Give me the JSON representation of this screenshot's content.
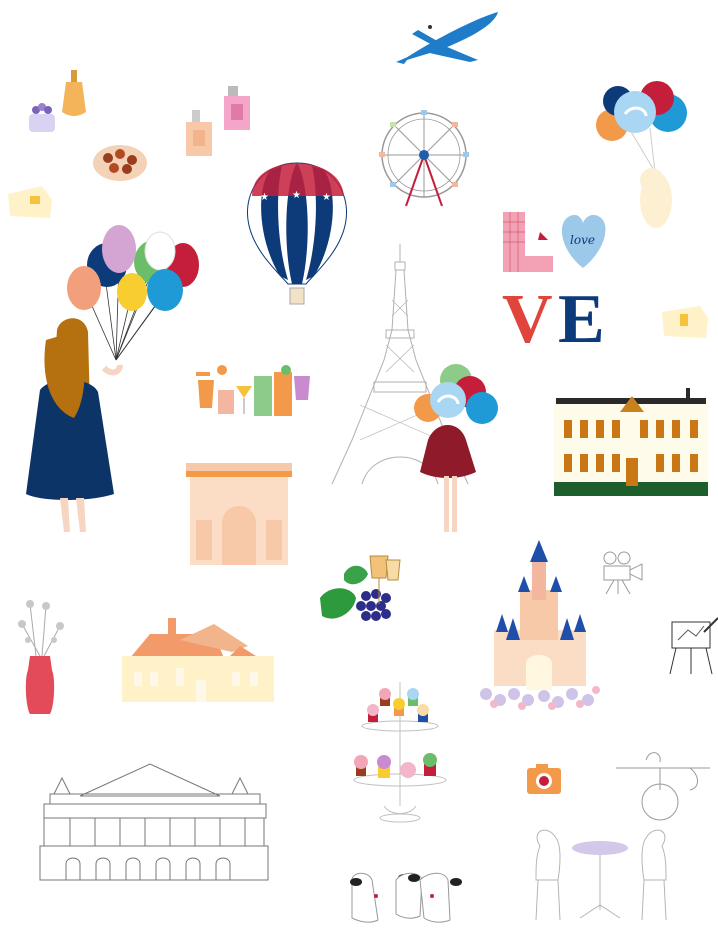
{
  "sticker_sheet": {
    "love_word": {
      "letter_l": "L",
      "letter_v": "V",
      "letter_e": "E",
      "heart_script": "love"
    },
    "colors": {
      "navy": "#0d3a78",
      "red": "#c41e3a",
      "love_red": "#e0443b",
      "plane_blue": "#1f7cc8",
      "heart_blue": "#9cc8ea",
      "dress_navy": "#0d3466",
      "hair": "#b5710f",
      "castle_pink": "#f3b69e",
      "cream": "#fff2c8",
      "line_gray": "#9a9a9a"
    },
    "icons": [
      "airplane-icon",
      "perfume-bottle-icon",
      "flower-pot-icon",
      "macaron-plate-icon",
      "cheese-icon",
      "ferris-wheel-icon",
      "hot-air-balloon-icon",
      "balloons-bear-icon",
      "love-heart-icon",
      "girl-with-balloons-icon",
      "eiffel-tower-icon",
      "cocktails-icon",
      "arc-de-triomphe-icon",
      "girl-in-red-icon",
      "chateau-icon",
      "grapes-wine-icon",
      "movie-camera-icon",
      "easel-icon",
      "castle-icon",
      "vase-icon",
      "house-icon",
      "cupcake-stand-icon",
      "opera-house-icon",
      "camera-icon",
      "cafe-table-icon",
      "street-lamp-icon",
      "dogs-icon"
    ]
  }
}
